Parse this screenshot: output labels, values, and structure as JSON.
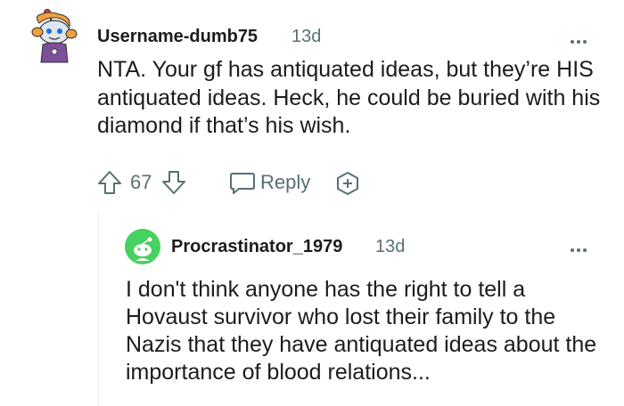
{
  "comment": {
    "username": "Username-dumb75",
    "time": "13d",
    "body": "NTA. Your gf has antiquated ideas, but they’re HIS antiquated ideas. Heck, he could be buried with his diamond if that’s his wish.",
    "score": "67",
    "reply_label": "Reply",
    "avatar_icon": "snoo-avatar-icon",
    "more_icon": "more-options-icon"
  },
  "reply": {
    "username": "Procrastinator_1979",
    "time": "13d",
    "body": "I don't think anyone has the right to tell a Hovaust survivor who lost their family to the Nazis that they have antiquated ideas about the importance of blood relations...",
    "avatar_icon": "default-avatar-icon",
    "more_icon": "more-options-icon"
  },
  "colors": {
    "text": "#1c1c1c",
    "meta": "#576f76",
    "reply_avatar": "#46d160",
    "thread_line": "#eef1f3"
  }
}
